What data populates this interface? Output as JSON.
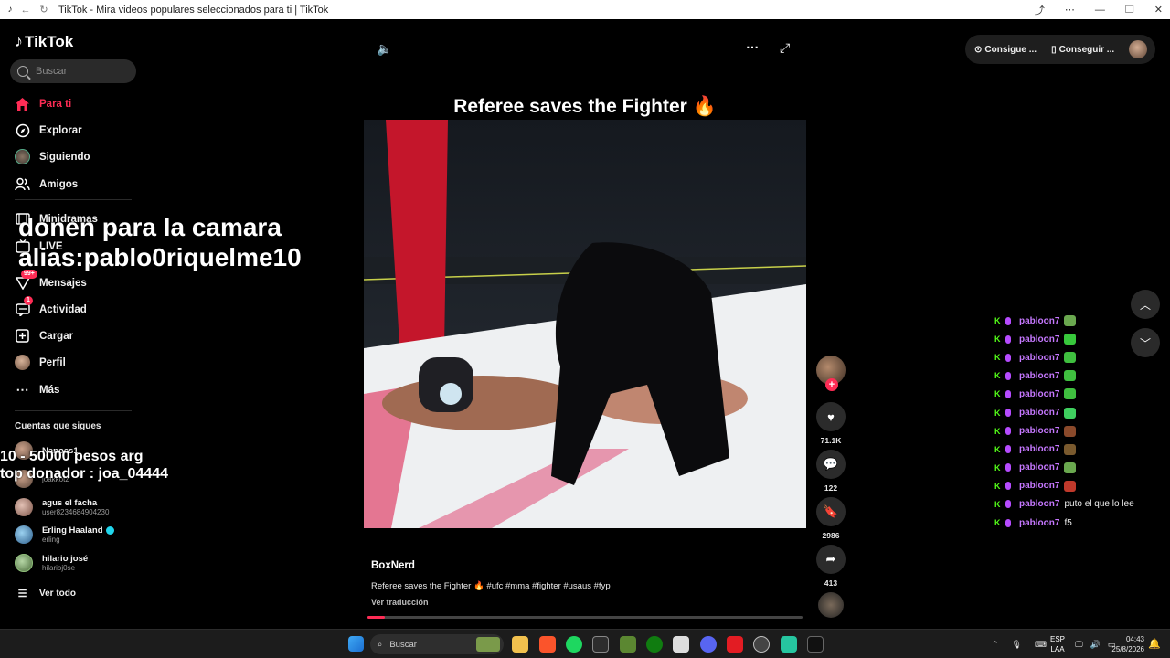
{
  "window": {
    "title": "TikTok - Mira videos populares seleccionados para ti | TikTok",
    "controls": [
      "⤴",
      "⋯",
      "—",
      "❐",
      "✕"
    ]
  },
  "sidebar": {
    "logo": "TikTok",
    "search_placeholder": "Buscar",
    "nav": [
      {
        "label": "Para ti",
        "icon": "home-icon"
      },
      {
        "label": "Explorar",
        "icon": "compass-icon"
      },
      {
        "label": "Siguiendo",
        "icon": "following-avatar-icon"
      },
      {
        "label": "Amigos",
        "icon": "friends-icon"
      },
      {
        "label": "Minidramas",
        "icon": "minidramas-icon"
      },
      {
        "label": "LIVE",
        "icon": "live-icon"
      },
      {
        "label": "Mensajes",
        "icon": "messages-icon",
        "badge": "99+"
      },
      {
        "label": "Actividad",
        "icon": "activity-icon",
        "badge": "1"
      },
      {
        "label": "Cargar",
        "icon": "upload-icon"
      },
      {
        "label": "Perfil",
        "icon": "profile-avatar-icon"
      },
      {
        "label": "Más",
        "icon": "more-icon"
      }
    ],
    "following_title": "Cuentas que sigues",
    "following": [
      {
        "name": "Nanocs1",
        "user": ""
      },
      {
        "name": "",
        "user": "joakkotz"
      },
      {
        "name": "agus el facha",
        "user": "user8234684904230"
      },
      {
        "name": "Erling Haaland",
        "user": "erling",
        "verified": true
      },
      {
        "name": "hilario josé",
        "user": "hilarioj0se"
      }
    ],
    "see_all": "Ver todo"
  },
  "overlay": {
    "line1": "donen para la camara",
    "line2": "alias:pablo0riquelme10",
    "line3": "10 - 50000 pesos arg",
    "line4": "top donador : joa_04444"
  },
  "video": {
    "title": "Referee saves the Fighter 🔥",
    "author": "BoxNerd",
    "description": "Referee saves the Fighter 🔥 #ufc #mma #fighter #usaus #fyp",
    "translate": "Ver traducción",
    "progress": 0.04
  },
  "actions": {
    "likes": "71.1K",
    "comments": "122",
    "saves": "2986",
    "shares": "413"
  },
  "topright": {
    "btn1": "Consigue ...",
    "btn2": "Conseguir ..."
  },
  "chat": [
    {
      "user": "pabloon7",
      "emote": "#6aa84f",
      "msg": ""
    },
    {
      "user": "pabloon7",
      "emote": "#38c93c",
      "msg": ""
    },
    {
      "user": "pabloon7",
      "emote": "#3fbf3f",
      "msg": ""
    },
    {
      "user": "pabloon7",
      "emote": "#3fbf3f",
      "msg": ""
    },
    {
      "user": "pabloon7",
      "emote": "#3fbf3f",
      "msg": ""
    },
    {
      "user": "pabloon7",
      "emote": "#3fcf5f",
      "msg": ""
    },
    {
      "user": "pabloon7",
      "emote": "#8b4a2b",
      "msg": ""
    },
    {
      "user": "pabloon7",
      "emote": "#7a5a2e",
      "msg": ""
    },
    {
      "user": "pabloon7",
      "emote": "#6aa84f",
      "msg": ""
    },
    {
      "user": "pabloon7",
      "emote": "#c0392b",
      "msg": ""
    },
    {
      "user": "pabloon7",
      "emote": "",
      "msg": "puto el que lo lee"
    },
    {
      "user": "pabloon7",
      "emote": "",
      "msg": "f5"
    }
  ],
  "taskbar": {
    "search": "Buscar",
    "lang1": "ESP",
    "lang2": "LAA",
    "time": "04:43",
    "date": "25/8/2026"
  }
}
